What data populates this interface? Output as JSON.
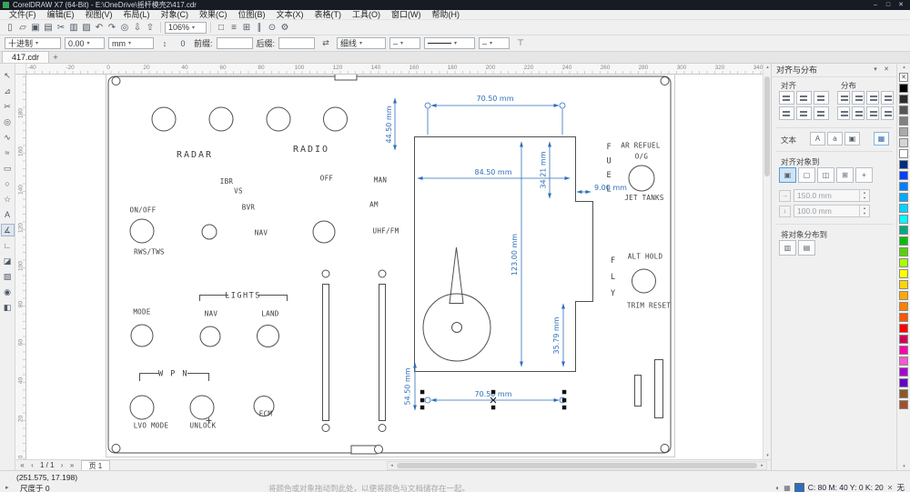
{
  "window": {
    "title": "CorelDRAW X7 (64-Bit) - E:\\OneDrive\\摇杆模壳2\\417.cdr",
    "minimize_glyph": "–",
    "maximize_glyph": "□",
    "close_glyph": "✕"
  },
  "menu": {
    "items": [
      {
        "name": "menu-file",
        "label": "文件(F)"
      },
      {
        "name": "menu-edit",
        "label": "编辑(E)"
      },
      {
        "name": "menu-view",
        "label": "视图(V)"
      },
      {
        "name": "menu-layout",
        "label": "布局(L)"
      },
      {
        "name": "menu-object",
        "label": "对象(C)"
      },
      {
        "name": "menu-effects",
        "label": "效果(C)"
      },
      {
        "name": "menu-bitmaps",
        "label": "位图(B)"
      },
      {
        "name": "menu-text",
        "label": "文本(X)"
      },
      {
        "name": "menu-table",
        "label": "表格(T)"
      },
      {
        "name": "menu-tools",
        "label": "工具(O)"
      },
      {
        "name": "menu-window",
        "label": "窗口(W)"
      },
      {
        "name": "menu-help",
        "label": "帮助(H)"
      }
    ]
  },
  "toolbar": {
    "zoom_level": "106%",
    "icons_left": [
      {
        "name": "new-document-icon",
        "glyph": "▯"
      },
      {
        "name": "open-icon",
        "glyph": "▱"
      },
      {
        "name": "save-icon",
        "glyph": "▣"
      },
      {
        "name": "print-icon",
        "glyph": "▤"
      },
      {
        "name": "cut-icon",
        "glyph": "✂"
      },
      {
        "name": "copy-icon",
        "glyph": "▥"
      },
      {
        "name": "paste-icon",
        "glyph": "▨"
      },
      {
        "name": "undo-icon",
        "glyph": "↶"
      },
      {
        "name": "redo-icon",
        "glyph": "↷"
      },
      {
        "name": "search-icon",
        "glyph": "◎"
      },
      {
        "name": "import-icon",
        "glyph": "⇩"
      },
      {
        "name": "export-icon",
        "glyph": "⇧"
      }
    ],
    "icons_right": [
      {
        "name": "fullscreen-preview-icon",
        "glyph": "□"
      },
      {
        "name": "show-rulers-icon",
        "glyph": "≡"
      },
      {
        "name": "show-grid-icon",
        "glyph": "⊞"
      },
      {
        "name": "show-guidelines-icon",
        "glyph": "∥"
      },
      {
        "name": "snap-to-icon",
        "glyph": "⊙"
      },
      {
        "name": "options-icon",
        "glyph": "⚙"
      }
    ]
  },
  "propbar": {
    "style_value": "十进制",
    "precision_value": "0.00",
    "units_value": "mm",
    "prefix_label": "前缀:",
    "suffix_label": "后缀:",
    "prefix_value": "",
    "suffix_value": "",
    "outline_width_value": "细线",
    "arrow_start_value": "–",
    "arrow_end_value": "–",
    "icons": [
      {
        "name": "show-units-toggle",
        "glyph": "↕"
      },
      {
        "name": "leading-zero-toggle",
        "glyph": "0"
      },
      {
        "name": "dynamic-dimensioning-toggle",
        "glyph": "⇄"
      },
      {
        "name": "text-position-dropdown",
        "glyph": "⊤"
      }
    ]
  },
  "doctabs": {
    "active_tab": "417.cdr",
    "new_tab_label": "+"
  },
  "rulers": {
    "horizontal": [
      "-40",
      "-20",
      "0",
      "20",
      "40",
      "60",
      "80",
      "100",
      "120",
      "140",
      "160",
      "180",
      "200",
      "220",
      "240",
      "260",
      "280",
      "300",
      "320",
      "340"
    ],
    "vertical": [
      "180",
      "160",
      "140",
      "120",
      "100",
      "80",
      "60",
      "40",
      "20",
      "0"
    ]
  },
  "toolbox": {
    "tools": [
      {
        "name": "pick-tool",
        "glyph": "↖"
      },
      {
        "name": "shape-tool",
        "glyph": "⊿"
      },
      {
        "name": "crop-tool",
        "glyph": "✂"
      },
      {
        "name": "zoom-tool",
        "glyph": "◎"
      },
      {
        "name": "freehand-tool",
        "glyph": "∿"
      },
      {
        "name": "artistic-media-tool",
        "glyph": "≈"
      },
      {
        "name": "rectangle-tool",
        "glyph": "▭"
      },
      {
        "name": "ellipse-tool",
        "glyph": "○"
      },
      {
        "name": "polygon-tool",
        "glyph": "☆"
      },
      {
        "name": "text-tool",
        "glyph": "A"
      },
      {
        "name": "dimension-tool",
        "glyph": "∡",
        "selected": true
      },
      {
        "name": "connector-tool",
        "glyph": "∟"
      },
      {
        "name": "shadow-tool",
        "glyph": "◪"
      },
      {
        "name": "transparency-tool",
        "glyph": "▨"
      },
      {
        "name": "eyedropper-tool",
        "glyph": "◉"
      },
      {
        "name": "fill-tool",
        "glyph": "◧"
      }
    ]
  },
  "panel": {
    "labels": {
      "radar": "RADAR",
      "radio": "RADIO",
      "ibr": "IBR",
      "vs": "VS",
      "off": "OFF",
      "man": "MAN",
      "bvr": "BVR",
      "am": "AM",
      "onoff": "ON/OFF",
      "nav": "NAV",
      "uhffm": "UHF/FM",
      "rwstws": "RWS/TWS",
      "lights": "LIGHTS",
      "mode": "MODE",
      "nav2": "NAV",
      "land": "LAND",
      "wpn": "W P N",
      "lvo": "LVO MODE",
      "unlock": "UNLOCK",
      "ecm": "ECM",
      "ar_refuel": "AR REFUEL",
      "og": "O/G",
      "jet_tanks": "JET TANKS",
      "alt_hold": "ALT HOLD",
      "trim_reset": "TRIM RESET"
    },
    "fuel": [
      "F",
      "U",
      "E",
      "L"
    ],
    "fly": [
      "F",
      "L",
      "Y"
    ],
    "dims": {
      "top_width": "70.50 mm",
      "top_height": "44.50 mm",
      "inner_width": "84.50 mm",
      "right_upper": "34.21 mm",
      "step": "9.00 mm",
      "inner_height": "123.00 mm",
      "right_lower": "35.79 mm",
      "bottom_height": "54.50 mm",
      "bottom_width": "70.50 mm"
    }
  },
  "docker": {
    "title": "对齐与分布",
    "flyout_glyph": "▾",
    "close_glyph": "✕",
    "align_label": "对齐",
    "distribute_label": "分布",
    "text_label": "文本",
    "text_settings_glyph": "▦",
    "align_to_label": "对齐对象到",
    "distribute_to_label": "将对象分布到",
    "x_value": "150.0 mm",
    "y_value": "100.0 mm",
    "spin_up": "▴",
    "spin_down": "▾",
    "align_icons": [
      {
        "name": "align-left-button"
      },
      {
        "name": "align-center-horizontal-button"
      },
      {
        "name": "align-right-button"
      },
      {
        "name": "align-top-button"
      },
      {
        "name": "align-center-vertical-button"
      },
      {
        "name": "align-bottom-button"
      }
    ],
    "distribute_icons": [
      {
        "name": "distribute-left-button"
      },
      {
        "name": "distribute-center-h-button"
      },
      {
        "name": "distribute-spacing-h-button"
      },
      {
        "name": "distribute-right-button"
      },
      {
        "name": "distribute-top-button"
      },
      {
        "name": "distribute-center-v-button"
      },
      {
        "name": "distribute-spacing-v-button"
      },
      {
        "name": "distribute-bottom-button"
      }
    ],
    "text_icons": [
      {
        "name": "text-first-line-button",
        "glyph": "A"
      },
      {
        "name": "text-baseline-button",
        "glyph": "a"
      },
      {
        "name": "text-bounding-box-button",
        "glyph": "▣"
      }
    ],
    "align_to_icons": [
      {
        "name": "align-to-active-objects-button",
        "glyph": "▣",
        "selected": true
      },
      {
        "name": "align-to-page-edge-button",
        "glyph": "▢"
      },
      {
        "name": "align-to-page-center-button",
        "glyph": "◫"
      },
      {
        "name": "align-to-grid-button",
        "glyph": "⊞"
      },
      {
        "name": "align-to-point-button",
        "glyph": "+"
      }
    ],
    "field_icons": [
      {
        "name": "point-x-icon",
        "glyph": "→"
      },
      {
        "name": "point-y-icon",
        "glyph": "↓"
      }
    ],
    "distribute_to_icons": [
      {
        "name": "distribute-to-selection-button",
        "glyph": "▥"
      },
      {
        "name": "distribute-to-page-button",
        "glyph": "▤"
      }
    ]
  },
  "palette": {
    "none_glyph": "✕",
    "up_glyph": "▴",
    "down_glyph": "▾",
    "colors": [
      "#000000",
      "#2b2b2b",
      "#555555",
      "#808080",
      "#aaaaaa",
      "#d4d4d4",
      "#ffffff",
      "#002b80",
      "#0040ff",
      "#0080ff",
      "#00aaff",
      "#00d4ff",
      "#00ffff",
      "#00aa80",
      "#00c000",
      "#55d400",
      "#aaff00",
      "#ffff00",
      "#ffd400",
      "#ffaa00",
      "#ff8000",
      "#ff5500",
      "#ff0000",
      "#d40055",
      "#ff00aa",
      "#ff55d4",
      "#aa00d4",
      "#6600cc",
      "#8b5a2b",
      "#a0522d"
    ]
  },
  "pagebar": {
    "nav_first": "«",
    "nav_prev": "‹",
    "page_indicator": "1 / 1",
    "nav_next": "›",
    "nav_last": "»",
    "page_label": "页 1",
    "scroll_left": "◂",
    "scroll_right": "▸"
  },
  "scrollbar": {
    "up": "▴",
    "down": "▾"
  },
  "status": {
    "coords": "(251.575, 17.198)",
    "tool_icon": "▸",
    "scale_text": "尺度于 0",
    "hint": "将颜色或对象拖动到此处，以便将颜色与文档储存在一起。",
    "icon_a": "◐",
    "icon_b": "▦",
    "fill_values": "C: 80 M: 40 Y: 0 K: 20",
    "fill_color": "#2f6db8",
    "outline_icon": "✕",
    "outline_value": "无"
  }
}
